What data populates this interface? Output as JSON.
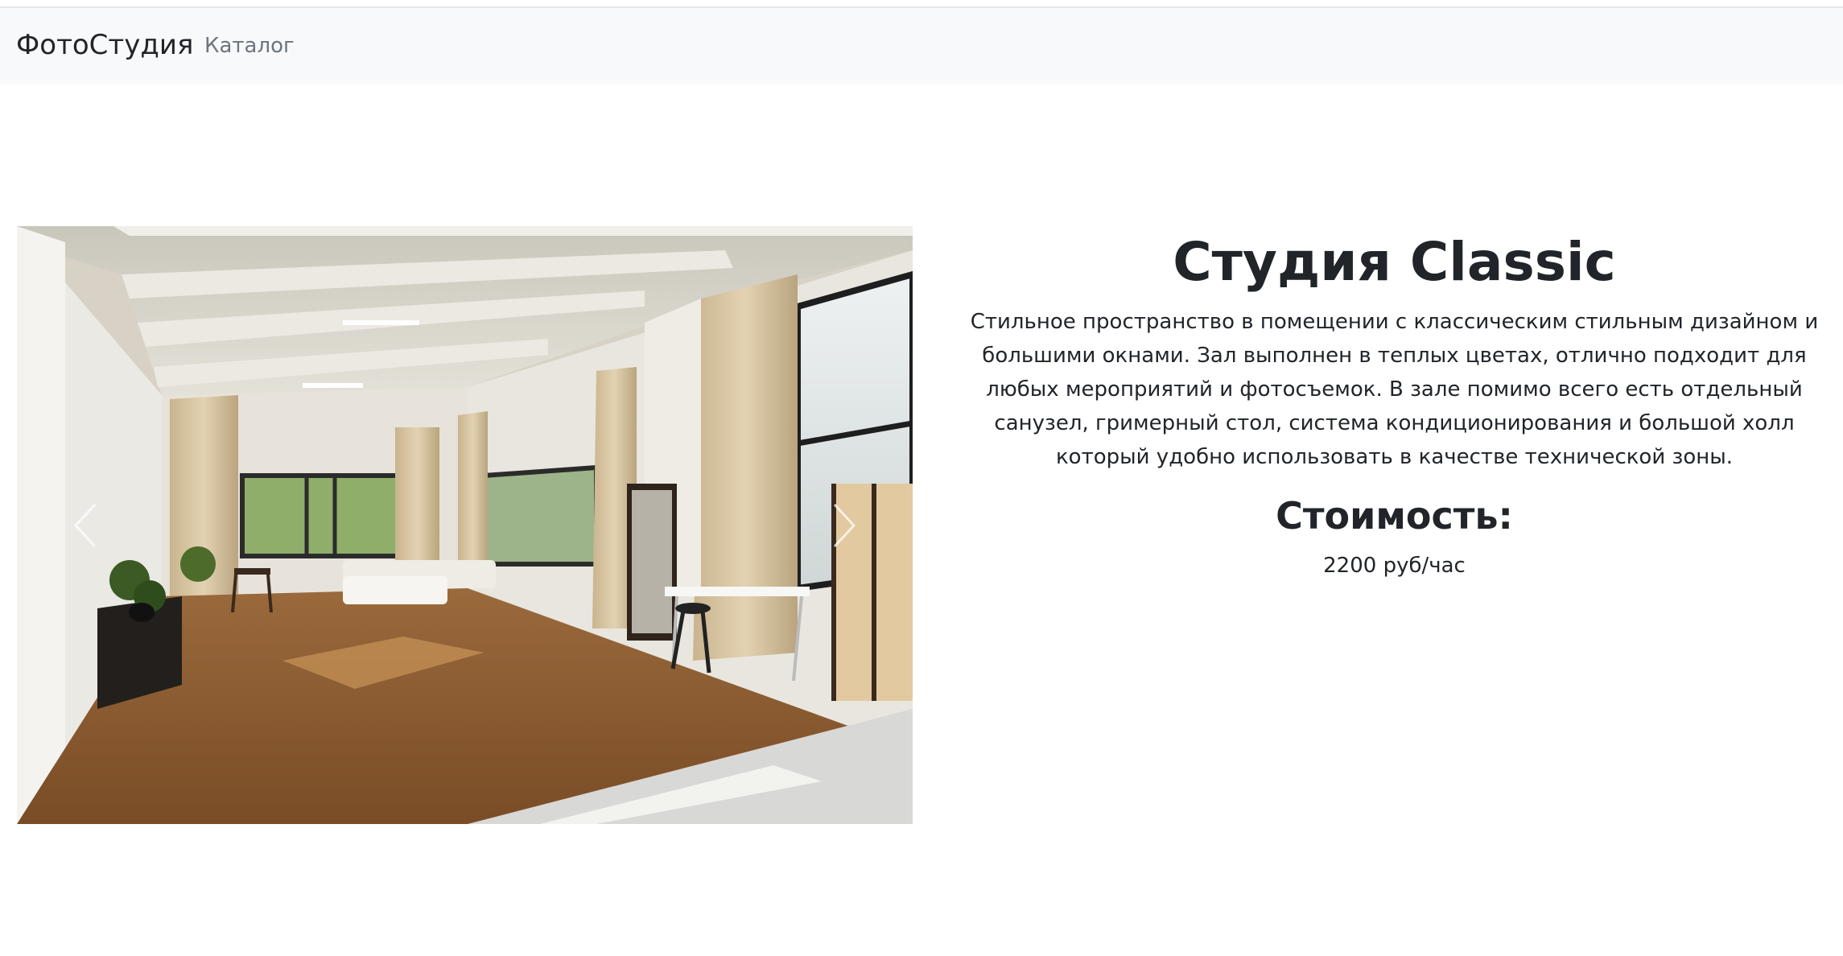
{
  "navbar": {
    "brand": "ФотоСтудия",
    "links": [
      "Каталог"
    ]
  },
  "carousel": {
    "image_description_icon": "studio-photo-image",
    "controls": {
      "prev_icon": "chevron-left-icon",
      "next_icon": "chevron-right-icon"
    }
  },
  "studio": {
    "title": "Студия Classic",
    "description": "Стильное пространство в помещении с классическим стильным дизайном и большими окнами. Зал выполнен в теплых цветах, отлично подходит для любых мероприятий и фотосъемок. В зале помимо всего есть отдельный санузел, гримерный стол, система кондиционирования и большой холл который удобно использовать в качестве технической зоны.",
    "price_heading": "Стоимость:",
    "price": "2200 руб/час"
  },
  "colors": {
    "navbar_bg": "#f8f9fa",
    "text": "#212529",
    "nav_link": "#6c757d"
  }
}
